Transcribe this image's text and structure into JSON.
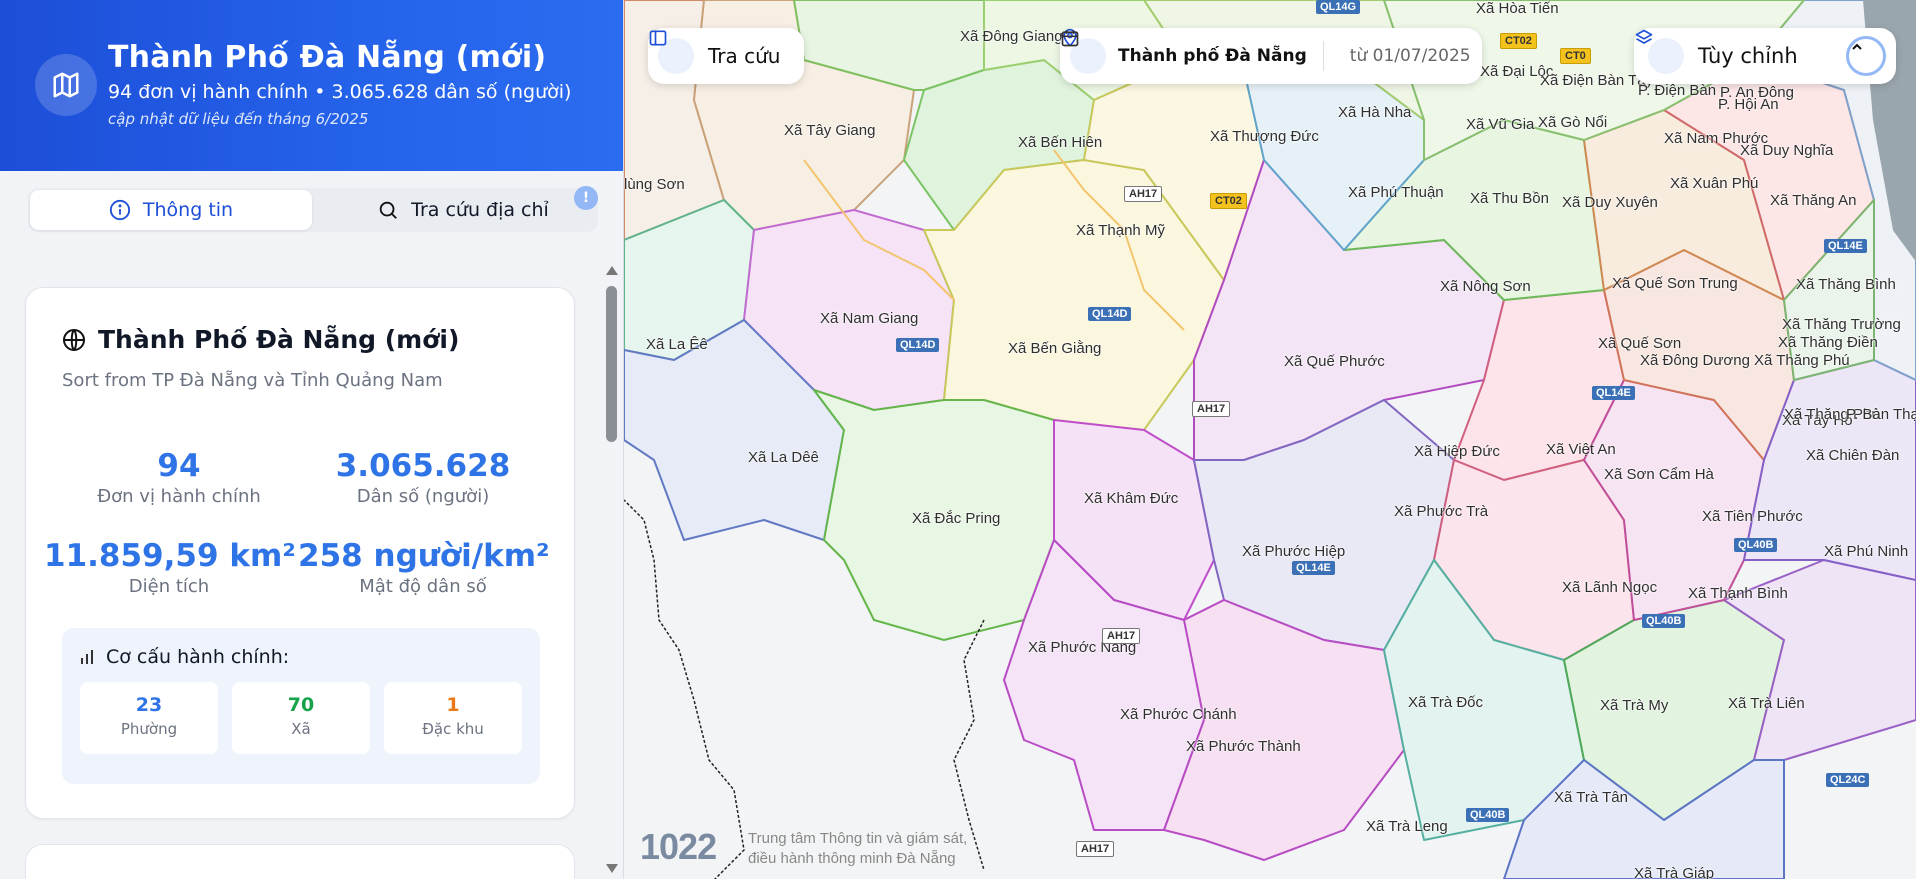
{
  "hero": {
    "title": "Thành Phố Đà Nẵng (mới)",
    "subtitle": "94 đơn vị hành chính • 3.065.628 dân số (người)",
    "note": "cập nhật dữ liệu đến tháng 6/2025",
    "icon": "map-icon"
  },
  "tabs": {
    "info_label": "Thông tin",
    "search_label": "Tra cứu địa chỉ",
    "badge": "!"
  },
  "card": {
    "title": "Thành Phố Đà Nẵng (mới)",
    "subtitle": "Sort from TP Đà Nẵng và Tỉnh Quảng Nam",
    "stats": [
      {
        "value": "94",
        "label": "Đơn vị hành chính"
      },
      {
        "value": "3.065.628",
        "label": "Dân số (người)"
      },
      {
        "value": "11.859,59 km²",
        "label": "Diện tích"
      },
      {
        "value": "258 người/km²",
        "label": "Mật độ dân số"
      }
    ],
    "structure": {
      "title": "Cơ cấu hành chính:",
      "items": [
        {
          "value": "23",
          "label": "Phường",
          "color": "#2f74e6"
        },
        {
          "value": "70",
          "label": "Xã",
          "color": "#16a34a"
        },
        {
          "value": "1",
          "label": "Đặc khu",
          "color": "#ea7a17"
        }
      ]
    }
  },
  "map_toolbar": {
    "lookup_label": "Tra cứu",
    "location_label": "Thành phố Đà Nẵng",
    "date_label": "từ 01/07/2025",
    "customize_label": "Tùy chỉnh"
  },
  "map_labels": [
    "Xã Đông Giang",
    "Xã Tây Giang",
    "Xã Bến Hiên",
    "Xã Thượng Đức",
    "Xã Hà Nha",
    "Xã Vũ Gia",
    "Xã Thạnh Mỹ",
    "Xã Phú Thuận",
    "Xã Thu Bồn",
    "Xã Duy Xuyên",
    "Xã Nam Giang",
    "Xã La Êê",
    "Xã Bến Giằng",
    "Xã Quế Phước",
    "Xã Nông Sơn",
    "Xã Quế Sơn Trung",
    "Xã Quế Sơn",
    "Xã La Dêê",
    "Xã Đắc Pring",
    "Xã Khâm Đức",
    "Xã Hiệp Đức",
    "Xã Việt An",
    "Xã Phước Trà",
    "Xã Phước Hiệp",
    "Xã Lãnh Ngọc",
    "Xã Thạnh Bình",
    "Xã Phước Năng",
    "Xã Phước Chánh",
    "Xã Phước Thành",
    "Xã Trà Đốc",
    "Xã Trà My",
    "Xã Trà Liên",
    "Xã Trà Leng",
    "Xã Trà Tân",
    "Xã Trà Giáp",
    "Xã Tiên Phước",
    "Xã Sơn Cẩm Hà",
    "Xã Đông Dương",
    "Xã Thăng Phú",
    "Xã Xuân Phú",
    "Xã Thăng An",
    "Xã Duy Nghĩa",
    "Xã Nam Phước",
    "Xã Gò Nổi",
    "Xã Hòa Tiến",
    "Xã Đại Lộc",
    "Xã Điện Bàn Tây",
    "Xã Thăng Bình",
    "Xã Thăng Điền",
    "Xã Tây Hồ",
    "Xã Chiên Đàn",
    "P. Điện Bàn",
    "P. An Đông",
    "P. Hội An",
    "Xã Phú Ninh",
    "Xã Thăng Trường",
    "Xã Thăng Phú",
    "P. Bàn Thạch",
    "lùng Sơn"
  ],
  "road_labels": [
    "QL14G",
    "AH17",
    "CT02",
    "QL14D",
    "QL14D",
    "AH17",
    "QL14E",
    "QL14E",
    "QL40B",
    "QL40B",
    "AH17",
    "QL40B",
    "AH17",
    "QL24C",
    "QL14E",
    "CT02",
    "CT0"
  ],
  "footer": {
    "logo": "1022",
    "line1": "Trung tâm Thông tin và giám sát,",
    "line2": "điều hành thông minh Đà Nẵng"
  }
}
